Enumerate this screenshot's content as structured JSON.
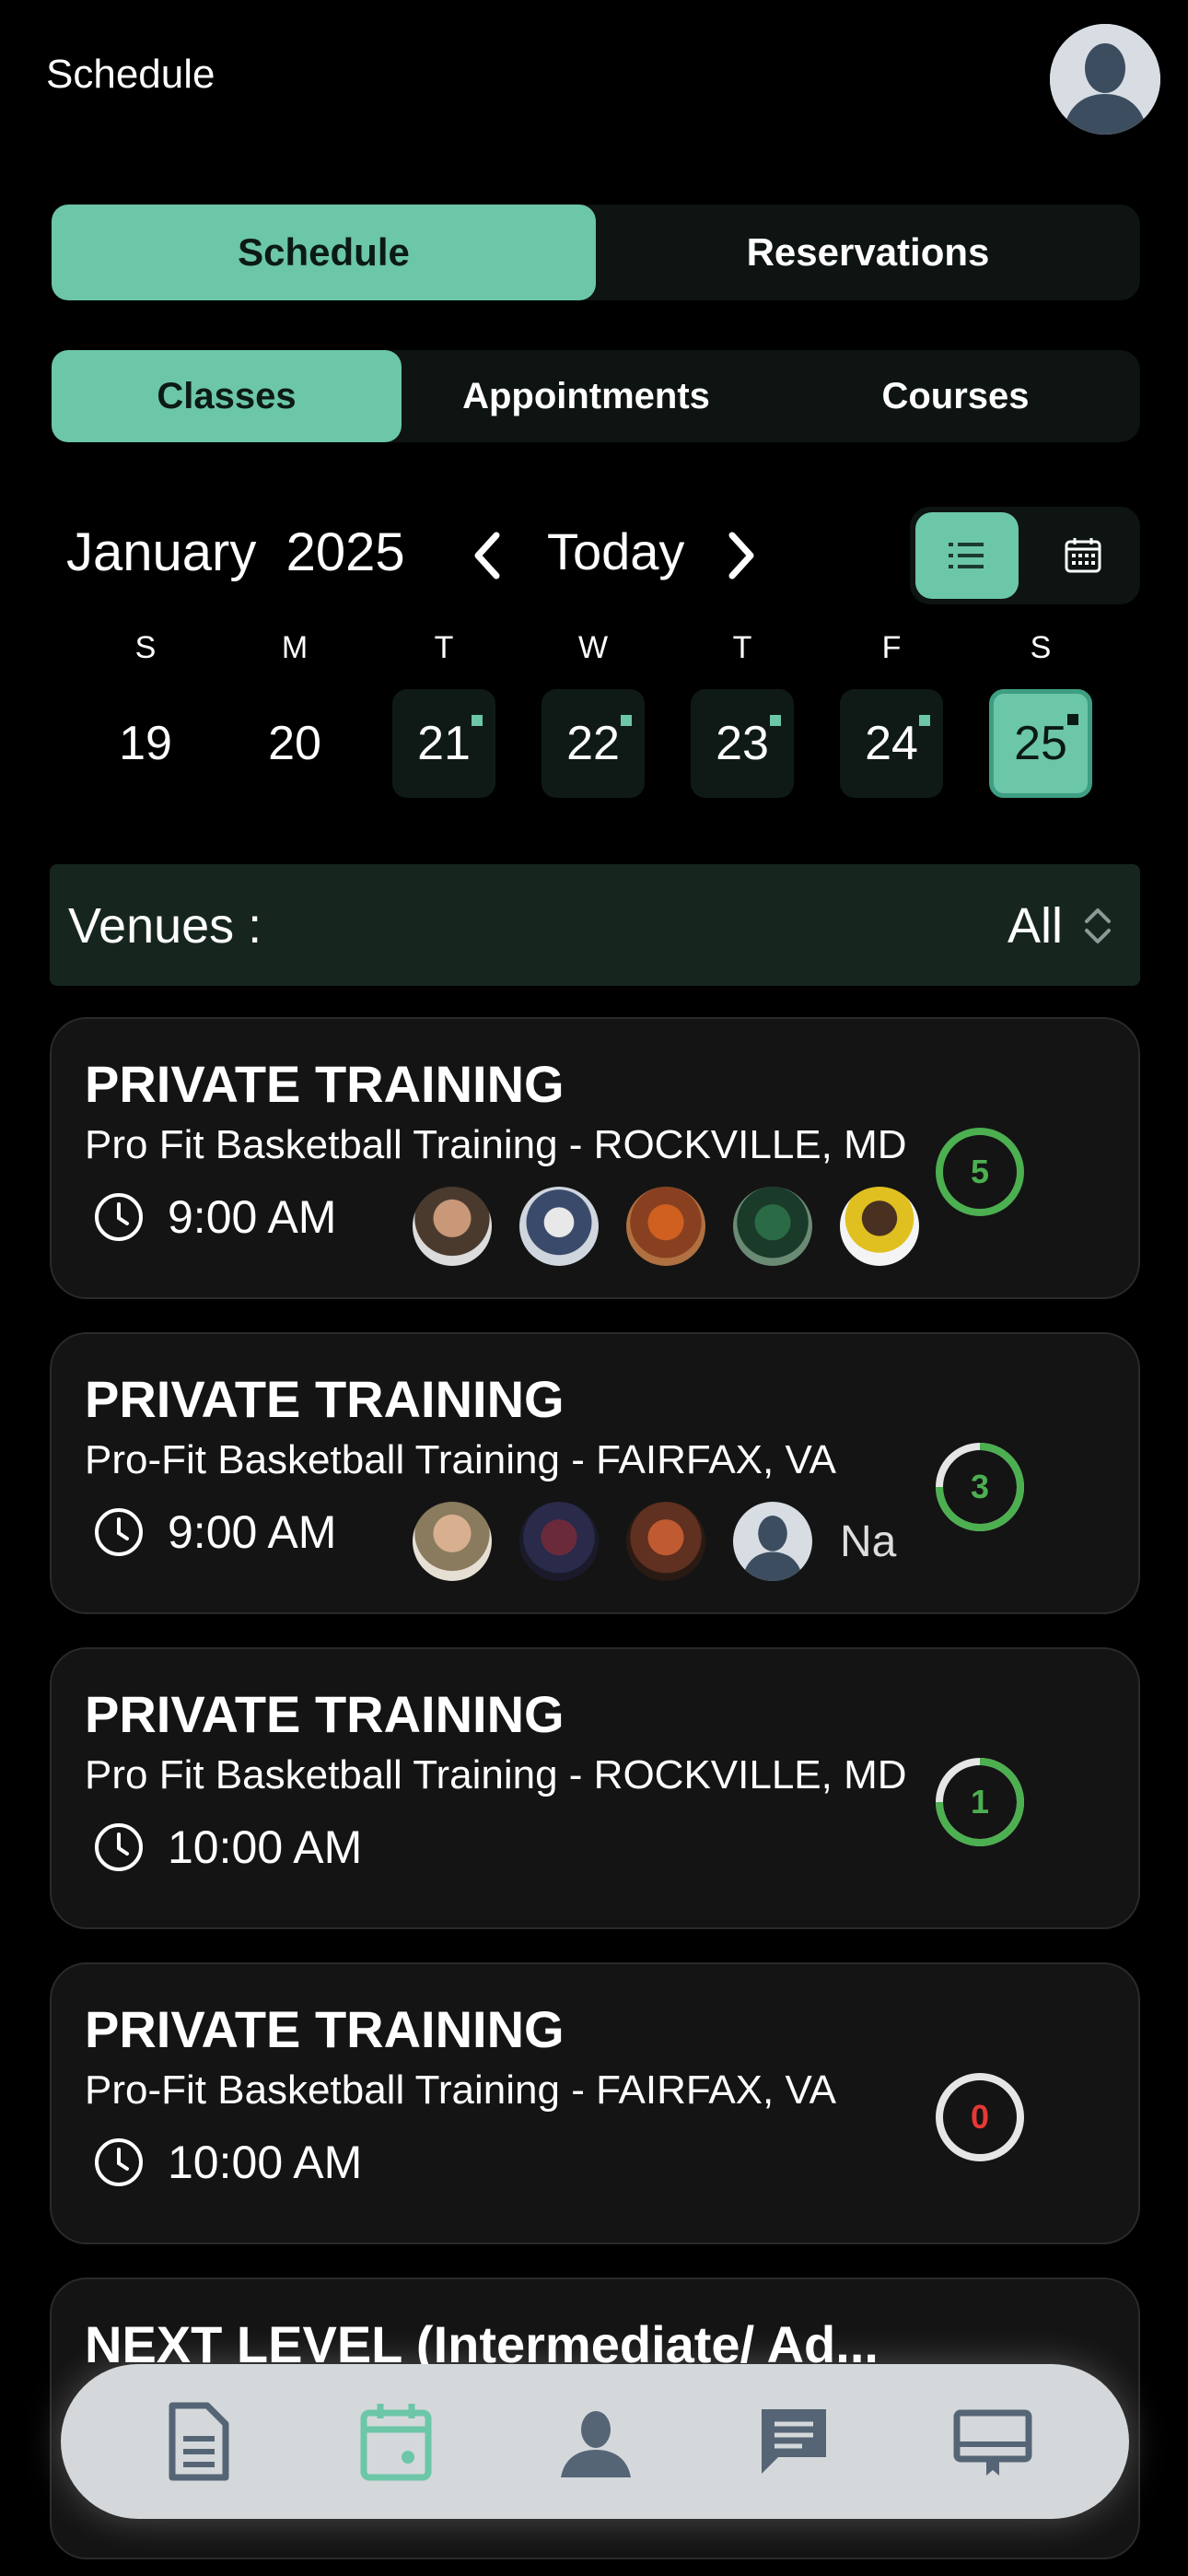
{
  "header": {
    "title": "Schedule"
  },
  "top_tabs": [
    {
      "label": "Schedule",
      "active": true
    },
    {
      "label": "Reservations",
      "active": false
    }
  ],
  "sub_tabs": [
    {
      "label": "Classes",
      "active": true
    },
    {
      "label": "Appointments",
      "active": false
    },
    {
      "label": "Courses",
      "active": false
    }
  ],
  "calendar": {
    "month": "January",
    "year": "2025",
    "today_label": "Today",
    "weekdays": [
      "S",
      "M",
      "T",
      "W",
      "T",
      "F",
      "S"
    ],
    "days": [
      {
        "num": "19",
        "has_events": false,
        "selected": false
      },
      {
        "num": "20",
        "has_events": false,
        "selected": false
      },
      {
        "num": "21",
        "has_events": true,
        "selected": false
      },
      {
        "num": "22",
        "has_events": true,
        "selected": false
      },
      {
        "num": "23",
        "has_events": true,
        "selected": false
      },
      {
        "num": "24",
        "has_events": true,
        "selected": false
      },
      {
        "num": "25",
        "has_events": true,
        "selected": true
      }
    ],
    "view_mode": "list"
  },
  "venues": {
    "label": "Venues :",
    "value": "All"
  },
  "classes": [
    {
      "title": "PRIVATE TRAINING",
      "venue": "Pro Fit Basketball Training - ROCKVILLE, MD",
      "time": "9:00 AM",
      "count": "5",
      "count_color": "#4caf50",
      "progress": 1.0,
      "attendee_extra": ""
    },
    {
      "title": "PRIVATE TRAINING",
      "venue": "Pro-Fit Basketball Training - FAIRFAX, VA",
      "time": "9:00 AM",
      "count": "3",
      "count_color": "#4caf50",
      "progress": 0.75,
      "attendee_extra": "Na"
    },
    {
      "title": "PRIVATE TRAINING",
      "venue": "Pro Fit Basketball Training - ROCKVILLE, MD",
      "time": "10:00 AM",
      "count": "1",
      "count_color": "#4caf50",
      "progress": 0.75,
      "attendee_extra": ""
    },
    {
      "title": "PRIVATE TRAINING",
      "venue": "Pro-Fit Basketball Training - FAIRFAX, VA",
      "time": "10:00 AM",
      "count": "0",
      "count_color": "#e53935",
      "progress": 0,
      "attendee_extra": ""
    },
    {
      "title": "NEXT LEVEL (Intermediate/ Ad...",
      "venue": "",
      "time": "",
      "count": "",
      "count_color": "#4caf50",
      "progress": 0,
      "attendee_extra": ""
    }
  ],
  "tabbar": {
    "items": [
      {
        "icon": "document-icon",
        "active": false
      },
      {
        "icon": "calendar-icon",
        "active": true
      },
      {
        "icon": "person-icon",
        "active": false
      },
      {
        "icon": "chat-icon",
        "active": false
      },
      {
        "icon": "board-icon",
        "active": false
      }
    ]
  },
  "colors": {
    "accent": "#6cc6a8",
    "ring_green": "#4caf50",
    "ring_red": "#e53935",
    "background": "#000000"
  }
}
